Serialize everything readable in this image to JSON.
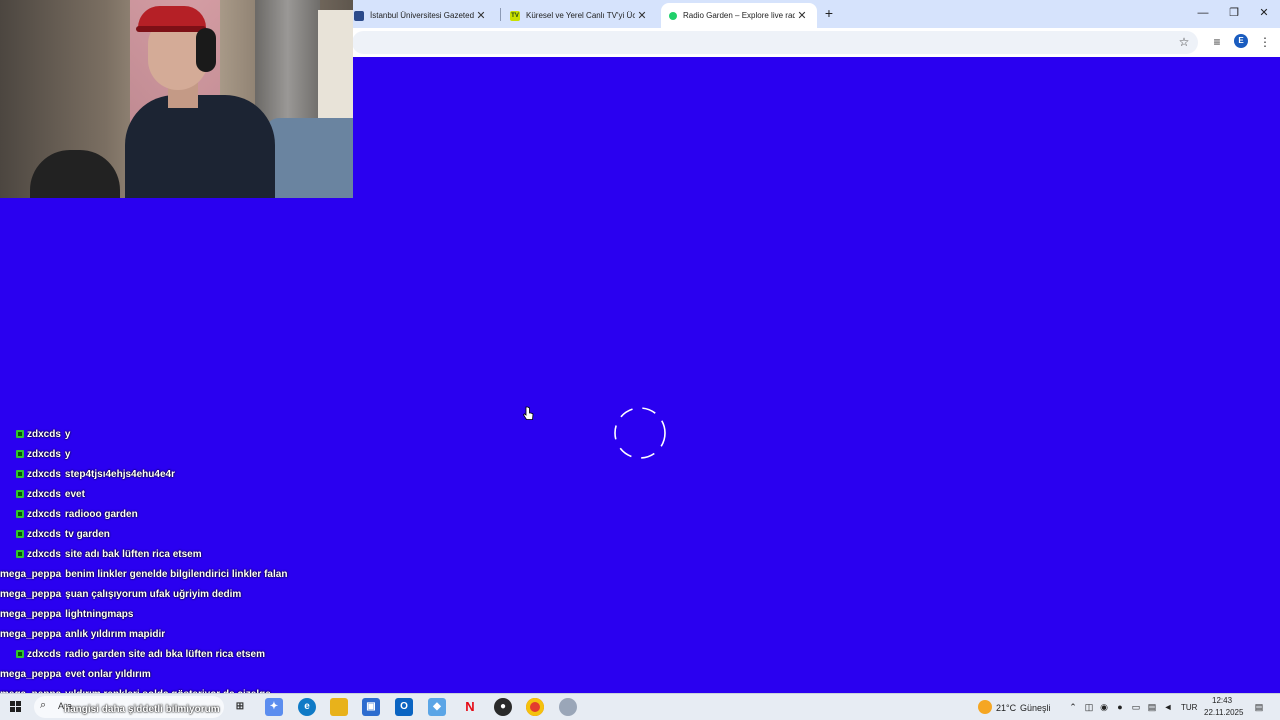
{
  "browser": {
    "tabs": [
      {
        "title": "İstanbul Üniversitesi Gazeteden",
        "favicon_color": "#2b4a8a"
      },
      {
        "title": "Küresel ve Yerel Canlı TV'yi Ücre",
        "favicon_color": "#c9e000",
        "favicon_text": "TV"
      },
      {
        "title": "Radio Garden – Explore live radi",
        "favicon_color": "#20d06a",
        "active": true
      }
    ],
    "new_tab": "+",
    "window_controls": {
      "minimize": "—",
      "restore": "❐",
      "close": "✕"
    },
    "profile_initial": "E"
  },
  "page": {
    "background_color": "#2a00f0",
    "loading": true
  },
  "chat": [
    {
      "user": "zdxcds",
      "badge": true,
      "message": "y"
    },
    {
      "user": "zdxcds",
      "badge": true,
      "message": "y"
    },
    {
      "user": "zdxcds",
      "badge": true,
      "message": "step4tjsı4ehjs4ehu4e4r"
    },
    {
      "user": "zdxcds",
      "badge": true,
      "message": "evet"
    },
    {
      "user": "zdxcds",
      "badge": true,
      "message": "radiooo garden"
    },
    {
      "user": "zdxcds",
      "badge": true,
      "message": "tv garden"
    },
    {
      "user": "zdxcds",
      "badge": true,
      "message": "site adı bak lüften rica etsem"
    },
    {
      "user": "mega_peppa",
      "badge": false,
      "message": "benim linkler genelde bilgilendirici linkler falan"
    },
    {
      "user": "mega_peppa",
      "badge": false,
      "message": "şuan çalışıyorum ufak uğriyim dedim"
    },
    {
      "user": "mega_peppa",
      "badge": false,
      "message": "lightningmaps"
    },
    {
      "user": "mega_peppa",
      "badge": false,
      "message": "anlık yıldırım mapidir"
    },
    {
      "user": "zdxcds",
      "badge": true,
      "message": "radio garden site adı bka lüften rica etsem"
    },
    {
      "user": "mega_peppa",
      "badge": false,
      "message": "evet onlar yıldırım"
    },
    {
      "user": "mega_peppa",
      "badge": false,
      "message": "yıldırım renkleri solda gösteriyor da çizelge"
    }
  ],
  "taskbar": {
    "search_text": "Ara",
    "overlay_text": "hangisi daha şiddetli bilmiyorum",
    "weather": {
      "temp": "21°C",
      "condition": "Güneşli"
    },
    "language": "TUR",
    "time": "12:43",
    "date": "22.11.2025",
    "apps": [
      {
        "name": "task-view",
        "color": "#5a6270",
        "glyph": "⊞"
      },
      {
        "name": "copilot",
        "color": "#5b8def",
        "glyph": "✦"
      },
      {
        "name": "edge",
        "color": "#0f7ac6",
        "glyph": "e"
      },
      {
        "name": "file-explorer",
        "color": "#e8b21b",
        "glyph": "▬"
      },
      {
        "name": "store",
        "color": "#2d6ccf",
        "glyph": "▣"
      },
      {
        "name": "outlook",
        "color": "#0a64c2",
        "glyph": "O"
      },
      {
        "name": "photos",
        "color": "#5ba5e6",
        "glyph": "◆"
      },
      {
        "name": "netflix",
        "color": "#e6e9ee",
        "glyph": "N",
        "glyph_color": "#e50914"
      },
      {
        "name": "obs",
        "color": "#2a2a2a",
        "glyph": "●"
      },
      {
        "name": "chrome",
        "color": "#e33b2e",
        "glyph": "◉"
      },
      {
        "name": "app-extra",
        "color": "#9aa6b8",
        "glyph": "◌"
      }
    ]
  }
}
